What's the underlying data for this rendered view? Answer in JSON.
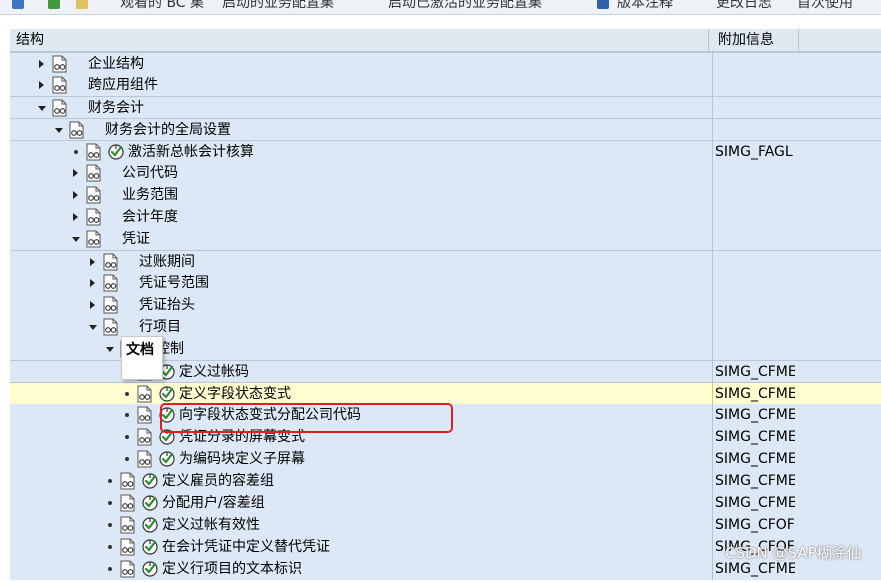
{
  "toolbar": {
    "items": [
      "观看的 BC 集",
      "启动的业务配置集",
      "启动已激活的业务配置集",
      "版本注释",
      "更改日志",
      "首次使用"
    ]
  },
  "header": {
    "col_structure": "结构",
    "col_extra": "附加信息"
  },
  "rows": [
    {
      "level": 0,
      "expander": "collapsed",
      "exec": false,
      "label": "企业结构",
      "info": "",
      "highlight": false
    },
    {
      "level": 0,
      "expander": "collapsed",
      "exec": false,
      "label": "跨应用组件",
      "info": "",
      "highlight": false
    },
    {
      "level": 0,
      "expander": "expanded",
      "exec": false,
      "label": "财务会计",
      "info": "",
      "highlight": false
    },
    {
      "level": 1,
      "expander": "expanded",
      "exec": false,
      "label": "财务会计的全局设置",
      "info": "",
      "highlight": false
    },
    {
      "level": 2,
      "expander": "leaf",
      "exec": true,
      "label": "激活新总帐会计核算",
      "info": "SIMG_FAGL",
      "highlight": false
    },
    {
      "level": 2,
      "expander": "collapsed",
      "exec": false,
      "label": "公司代码",
      "info": "",
      "highlight": false
    },
    {
      "level": 2,
      "expander": "collapsed",
      "exec": false,
      "label": "业务范围",
      "info": "",
      "highlight": false
    },
    {
      "level": 2,
      "expander": "collapsed",
      "exec": false,
      "label": "会计年度",
      "info": "",
      "highlight": false
    },
    {
      "level": 2,
      "expander": "expanded",
      "exec": false,
      "label": "凭证",
      "info": "",
      "highlight": false
    },
    {
      "level": 3,
      "expander": "collapsed",
      "exec": false,
      "label": "过账期间",
      "info": "",
      "highlight": false
    },
    {
      "level": 3,
      "expander": "collapsed",
      "exec": false,
      "label": "凭证号范围",
      "info": "",
      "highlight": false
    },
    {
      "level": 3,
      "expander": "collapsed",
      "exec": false,
      "label": "凭证抬头",
      "info": "",
      "highlight": false
    },
    {
      "level": 3,
      "expander": "expanded",
      "exec": false,
      "label": "行项目",
      "info": "",
      "highlight": false
    },
    {
      "level": 4,
      "expander": "expanded",
      "exec": false,
      "label": "控制",
      "info": "",
      "highlight": false
    },
    {
      "level": 5,
      "expander": "leaf",
      "exec": true,
      "label": "定义过帐码",
      "info": "SIMG_CFME",
      "highlight": false
    },
    {
      "level": 5,
      "expander": "leaf",
      "exec": true,
      "label": "定义字段状态变式",
      "info": "SIMG_CFME",
      "highlight": true
    },
    {
      "level": 5,
      "expander": "leaf",
      "exec": true,
      "label": "向字段状态变式分配公司代码",
      "info": "SIMG_CFME",
      "highlight": false
    },
    {
      "level": 5,
      "expander": "leaf",
      "exec": true,
      "label": "凭证分录的屏幕变式",
      "info": "SIMG_CFME",
      "highlight": false
    },
    {
      "level": 5,
      "expander": "leaf",
      "exec": true,
      "label": "为编码块定义子屏幕",
      "info": "SIMG_CFME",
      "highlight": false
    },
    {
      "level": 4,
      "expander": "leaf",
      "exec": true,
      "label": "定义雇员的容差组",
      "info": "SIMG_CFME",
      "highlight": false
    },
    {
      "level": 4,
      "expander": "leaf",
      "exec": true,
      "label": "分配用户/容差组",
      "info": "SIMG_CFME",
      "highlight": false
    },
    {
      "level": 4,
      "expander": "leaf",
      "exec": true,
      "label": "定义过帐有效性",
      "info": "SIMG_CFOF",
      "highlight": false
    },
    {
      "level": 4,
      "expander": "leaf",
      "exec": true,
      "label": "在会计凭证中定义替代凭证",
      "info": "SIMG_CFOF",
      "highlight": false
    },
    {
      "level": 4,
      "expander": "leaf",
      "exec": true,
      "label": "定义行项目的文本标识",
      "info": "SIMG_CFME",
      "highlight": false
    }
  ],
  "tooltip": {
    "text": "文档"
  },
  "watermark": {
    "text": "CSDN @SAP糊涂仙"
  },
  "colors": {
    "row_bg": "#dce8f5",
    "highlight_bg": "#fefed0",
    "annotation_box": "#e21f1f"
  }
}
